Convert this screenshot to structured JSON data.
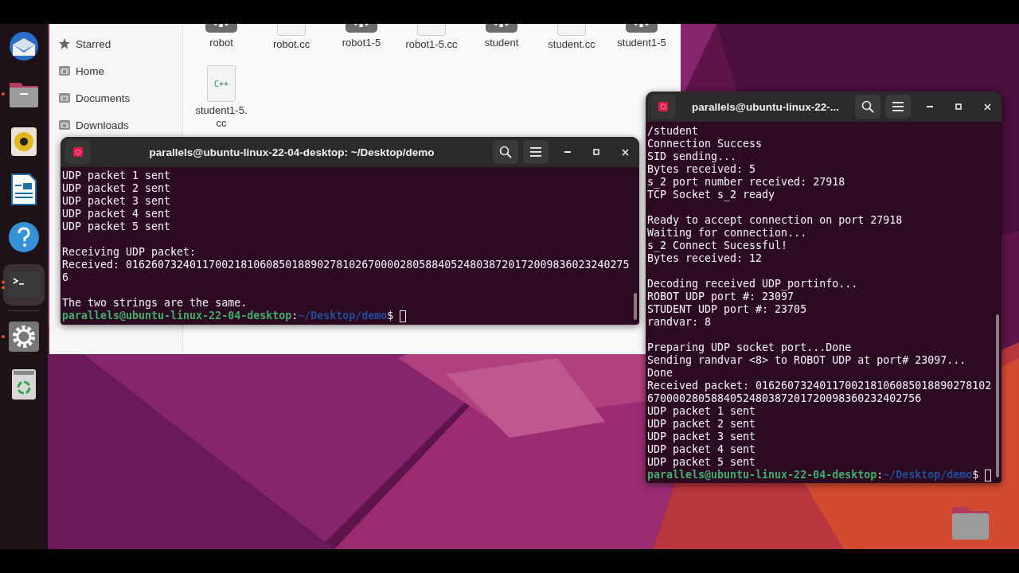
{
  "dock": {
    "items": [
      {
        "kind": "mail",
        "running": false,
        "active": false
      },
      {
        "kind": "files",
        "running": true,
        "multiple_windows": false,
        "active": false
      },
      {
        "kind": "music",
        "running": false,
        "active": false
      },
      {
        "kind": "writer",
        "running": false,
        "active": false
      },
      {
        "kind": "help",
        "running": false,
        "active": false
      },
      {
        "kind": "terminal",
        "running": true,
        "multiple_windows": true,
        "active": true
      },
      {
        "kind": "settings",
        "running": true,
        "multiple_windows": false,
        "active": false
      },
      {
        "kind": "trash",
        "running": false,
        "active": false
      }
    ]
  },
  "file_manager": {
    "sidebar": {
      "items": [
        {
          "kind": "starred",
          "label": "Starred"
        },
        {
          "kind": "folder",
          "label": "Home"
        },
        {
          "kind": "folder",
          "label": "Documents"
        },
        {
          "kind": "folder",
          "label": "Downloads"
        }
      ]
    },
    "files": [
      {
        "name": "robot",
        "kind": "executable"
      },
      {
        "name": "robot.cc",
        "kind": "source"
      },
      {
        "name": "robot1-5",
        "kind": "executable"
      },
      {
        "name": "robot1-5.cc",
        "kind": "source"
      },
      {
        "name": "student",
        "kind": "executable"
      },
      {
        "name": "student.cc",
        "kind": "source"
      },
      {
        "name": "student1-5",
        "kind": "executable"
      },
      {
        "name": "student1-5.cc",
        "kind": "source",
        "icon_text": "C++"
      }
    ]
  },
  "terminals": [
    {
      "title": "parallels@ubuntu-linux-22-04-desktop: ~/Desktop/demo",
      "lines": [
        {
          "text": "UDP packet 1 sent"
        },
        {
          "text": "UDP packet 2 sent"
        },
        {
          "text": "UDP packet 3 sent"
        },
        {
          "text": "UDP packet 4 sent"
        },
        {
          "text": "UDP packet 5 sent"
        },
        {
          "kind": "blank"
        },
        {
          "text": "Receiving UDP packet:"
        },
        {
          "text": "Received: 0162607324011700218106085018890278102670000280588405248038720172009836023240275"
        },
        {
          "text": "6"
        },
        {
          "kind": "blank"
        },
        {
          "text": "The two strings are the same."
        },
        {
          "kind": "prompt",
          "user": "parallels@ubuntu-linux-22-04-desktop",
          "sep": ":",
          "path": "~/Desktop/demo",
          "sign": "$"
        }
      ]
    },
    {
      "title": "parallels@ubuntu-linux-22-...",
      "lines": [
        {
          "text": "/student"
        },
        {
          "text": "Connection Success"
        },
        {
          "text": "SID sending..."
        },
        {
          "text": "Bytes received: 5"
        },
        {
          "text": "s_2 port number received: 27918"
        },
        {
          "text": "TCP Socket s_2 ready"
        },
        {
          "kind": "blank"
        },
        {
          "text": "Ready to accept connection on port 27918"
        },
        {
          "text": "Waiting for connection..."
        },
        {
          "text": "s_2 Connect Sucessful!"
        },
        {
          "text": "Bytes received: 12"
        },
        {
          "kind": "blank"
        },
        {
          "text": "Decoding received UDP_portinfo..."
        },
        {
          "text": "ROBOT UDP port #: 23097"
        },
        {
          "text": "STUDENT UDP port #: 23705"
        },
        {
          "text": "randvar: 8"
        },
        {
          "kind": "blank"
        },
        {
          "text": "Preparing UDP socket port...Done"
        },
        {
          "text": "Sending randvar <8> to ROBOT UDP at port# 23097..."
        },
        {
          "text": "Done"
        },
        {
          "text": "Received packet: 0162607324011700218106085018890278102"
        },
        {
          "text": "6700002805884052480387201720098360232402756"
        },
        {
          "text": "UDP packet 1 sent"
        },
        {
          "text": "UDP packet 2 sent"
        },
        {
          "text": "UDP packet 3 sent"
        },
        {
          "text": "UDP packet 4 sent"
        },
        {
          "text": "UDP packet 5 sent"
        },
        {
          "kind": "prompt",
          "user": "parallels@ubuntu-linux-22-04-desktop",
          "sep": ":",
          "path": "~/Desktop/demo",
          "sign": "$"
        }
      ]
    }
  ]
}
